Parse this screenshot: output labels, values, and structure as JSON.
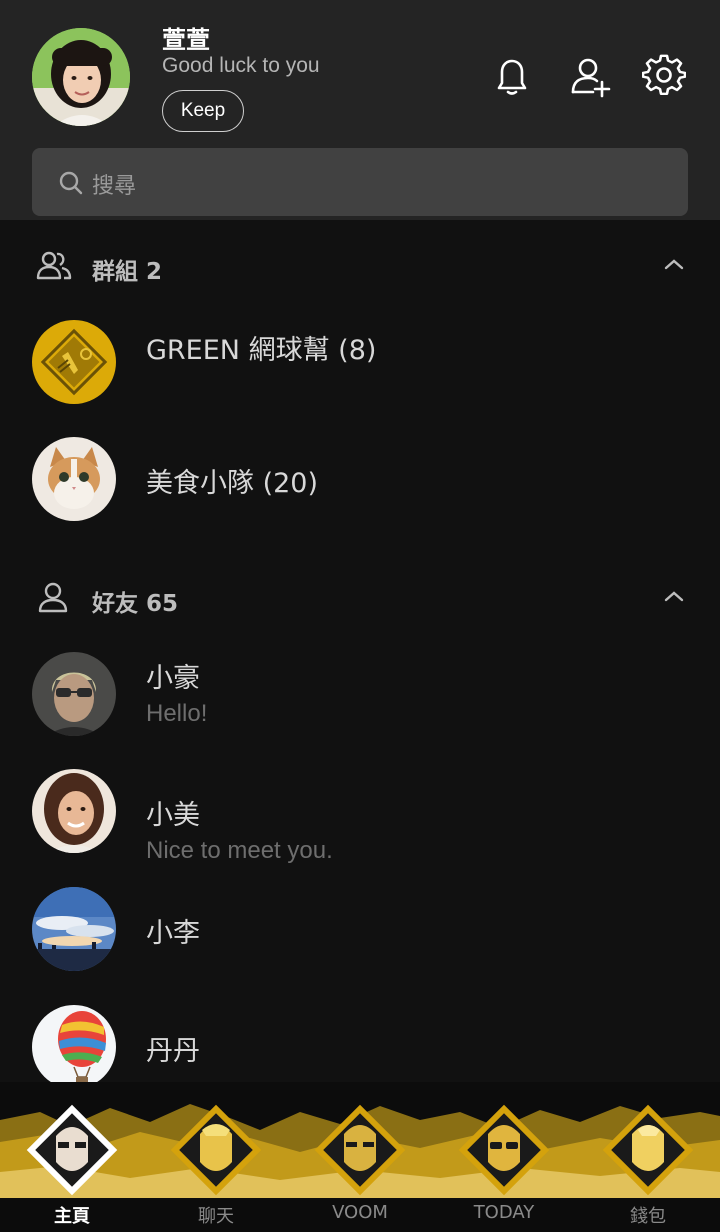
{
  "profile": {
    "name": "萱萱",
    "status": "Good luck to you",
    "keep_label": "Keep"
  },
  "header_icons": [
    "bell-icon",
    "add-friend-icon",
    "gear-icon"
  ],
  "search": {
    "placeholder": "搜尋"
  },
  "groups": {
    "title": "群組 2",
    "items": [
      {
        "name": "GREEN 網球幫 (8)"
      },
      {
        "name": "美食小隊 (20)"
      }
    ]
  },
  "friends": {
    "title": "好友 65",
    "items": [
      {
        "name": "小豪",
        "status": "Hello!"
      },
      {
        "name": "小美",
        "status": "Nice to meet you."
      },
      {
        "name": "小李",
        "status": ""
      },
      {
        "name": "丹丹",
        "status": ""
      }
    ]
  },
  "nav": {
    "items": [
      {
        "label": "主頁",
        "active": true
      },
      {
        "label": "聊天",
        "active": false
      },
      {
        "label": "VOOM",
        "active": false
      },
      {
        "label": "TODAY",
        "active": false
      },
      {
        "label": "錢包",
        "active": false
      }
    ]
  },
  "colors": {
    "background": "#111111",
    "header": "#242424",
    "search_field": "#414141",
    "accent_gold": "#d4a20c"
  }
}
